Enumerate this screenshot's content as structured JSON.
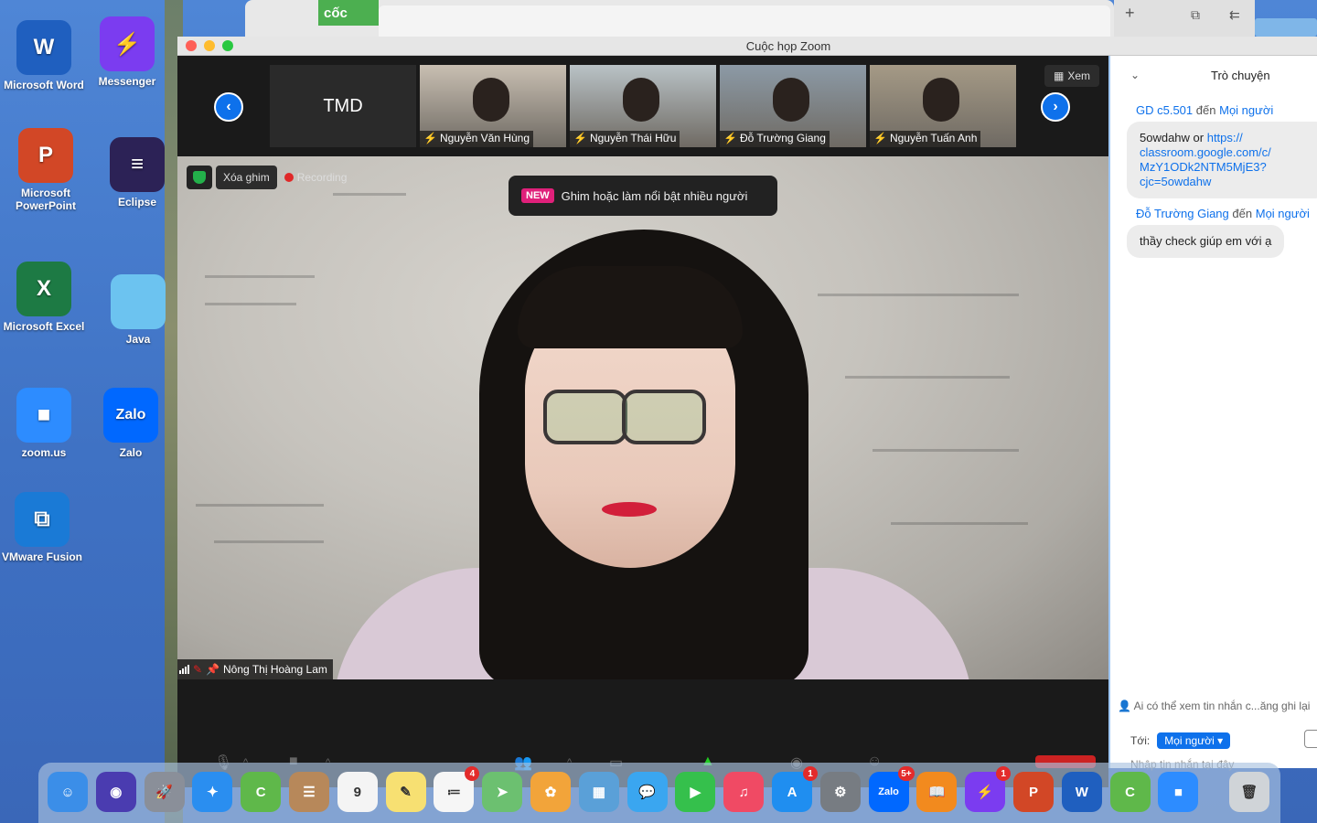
{
  "desktop": {
    "icons": [
      {
        "label": "Microsoft Word",
        "glyph": "W",
        "color": "#1f5fbf",
        "icon": "word-icon"
      },
      {
        "label": "Messenger",
        "glyph": "⚡",
        "color": "#7b3cf0",
        "icon": "messenger-icon"
      },
      {
        "label": "Microsoft PowerPoint",
        "glyph": "P",
        "color": "#d24726",
        "icon": "powerpoint-icon"
      },
      {
        "label": "Eclipse",
        "glyph": "≡",
        "color": "#2c2256",
        "icon": "eclipse-icon"
      },
      {
        "label": "Microsoft Excel",
        "glyph": "X",
        "color": "#1d7a44",
        "icon": "excel-icon"
      },
      {
        "label": "Java",
        "glyph": "",
        "color": "#6cc3f0",
        "icon": "folder-icon"
      },
      {
        "label": "zoom.us",
        "glyph": "■",
        "color": "#2d8cff",
        "icon": "zoom-icon"
      },
      {
        "label": "Zalo",
        "glyph": "Zalo",
        "color": "#0068ff",
        "icon": "zalo-icon"
      },
      {
        "label": "VMware Fusion",
        "glyph": "⧉",
        "color": "#1a7ad6",
        "icon": "vmware-icon"
      }
    ]
  },
  "browser": {
    "tab_label": "cốc"
  },
  "window": {
    "title": "Cuộc họp Zoom"
  },
  "gallery": {
    "tmd_label": "TMD",
    "participants": [
      {
        "name": "Nguyễn Văn Hùng",
        "bg": "#c9bfb2"
      },
      {
        "name": "Nguyễn Thái Hữu",
        "bg": "#b9c2c6"
      },
      {
        "name": "Đỗ Trường Giang",
        "bg": "#8c9aa6"
      },
      {
        "name": "Nguyễn Tuấn Anh",
        "bg": "#a59a86"
      }
    ],
    "view_button": "Xem"
  },
  "main": {
    "unpin_label": "Xóa ghim",
    "recording_label": "Recording",
    "tip_badge": "NEW",
    "tip_text": "Ghim hoặc làm nổi bật nhiều người",
    "speaker_name": "Nông Thị Hoàng Lam"
  },
  "chat": {
    "title": "Trò chuyện",
    "messages": [
      {
        "sender": "GD c5.501",
        "connector": "đến",
        "recipient": "Mọi người",
        "text": "5owdahw or ",
        "link": "https://\nclassroom.google.com/c/\nMzY1ODk2NTM5MjE3?\ncjc=5owdahw"
      },
      {
        "sender": "Đỗ Trường Giang",
        "connector": "đến",
        "recipient": "Mọi người",
        "text": "thầy check giúp em với ạ",
        "link": ""
      }
    ],
    "privacy_note": "Ai có thể xem tin nhắn c...ăng ghi lại",
    "to_label": "Tới:",
    "to_value": "Mọi người ▾",
    "input_placeholder": "Nhập tin nhắn tại đây"
  },
  "dock": {
    "apps": [
      {
        "name": "finder-icon",
        "glyph": "☺",
        "color": "#3b8ee8",
        "badge": ""
      },
      {
        "name": "siri-icon",
        "glyph": "◉",
        "color": "#4a3cb0",
        "badge": ""
      },
      {
        "name": "launchpad-icon",
        "glyph": "🚀",
        "color": "#8a8f99",
        "badge": ""
      },
      {
        "name": "safari-icon",
        "glyph": "✦",
        "color": "#2a8ef0",
        "badge": ""
      },
      {
        "name": "coccoc-icon",
        "glyph": "C",
        "color": "#5fb84a",
        "badge": ""
      },
      {
        "name": "contacts-icon",
        "glyph": "☰",
        "color": "#b7885a",
        "badge": ""
      },
      {
        "name": "calendar-icon",
        "glyph": "9",
        "color": "#f4f4f4",
        "badge": ""
      },
      {
        "name": "notes-icon",
        "glyph": "✎",
        "color": "#f7e072",
        "badge": ""
      },
      {
        "name": "reminders-icon",
        "glyph": "≔",
        "color": "#f6f6f6",
        "badge": "4"
      },
      {
        "name": "maps-icon",
        "glyph": "➤",
        "color": "#6cc070",
        "badge": ""
      },
      {
        "name": "photos-icon",
        "glyph": "✿",
        "color": "#f2a43a",
        "badge": ""
      },
      {
        "name": "preview-icon",
        "glyph": "▦",
        "color": "#5aa0d8",
        "badge": ""
      },
      {
        "name": "messages-icon",
        "glyph": "💬",
        "color": "#3aa6f0",
        "badge": ""
      },
      {
        "name": "facetime-icon",
        "glyph": "▶",
        "color": "#35c04c",
        "badge": ""
      },
      {
        "name": "music-icon",
        "glyph": "♫",
        "color": "#f04a64",
        "badge": ""
      },
      {
        "name": "app-store-icon",
        "glyph": "A",
        "color": "#1f8ef0",
        "badge": "1"
      },
      {
        "name": "system-preferences-icon",
        "glyph": "⚙",
        "color": "#777c82",
        "badge": ""
      },
      {
        "name": "zalo-icon",
        "glyph": "Zalo",
        "color": "#0068ff",
        "badge": "5+"
      },
      {
        "name": "books-icon",
        "glyph": "📖",
        "color": "#f28a1e",
        "badge": ""
      },
      {
        "name": "messenger-icon",
        "glyph": "⚡",
        "color": "#7b3cf0",
        "badge": "1"
      },
      {
        "name": "powerpoint-icon",
        "glyph": "P",
        "color": "#d24726",
        "badge": ""
      },
      {
        "name": "word-icon",
        "glyph": "W",
        "color": "#1f5fbf",
        "badge": ""
      },
      {
        "name": "coccoc-icon-2",
        "glyph": "C",
        "color": "#5fb84a",
        "badge": ""
      },
      {
        "name": "zoom-icon",
        "glyph": "■",
        "color": "#2d8cff",
        "badge": ""
      },
      {
        "name": "trash-icon",
        "glyph": "🗑",
        "color": "#d0d4d8",
        "badge": ""
      }
    ]
  }
}
